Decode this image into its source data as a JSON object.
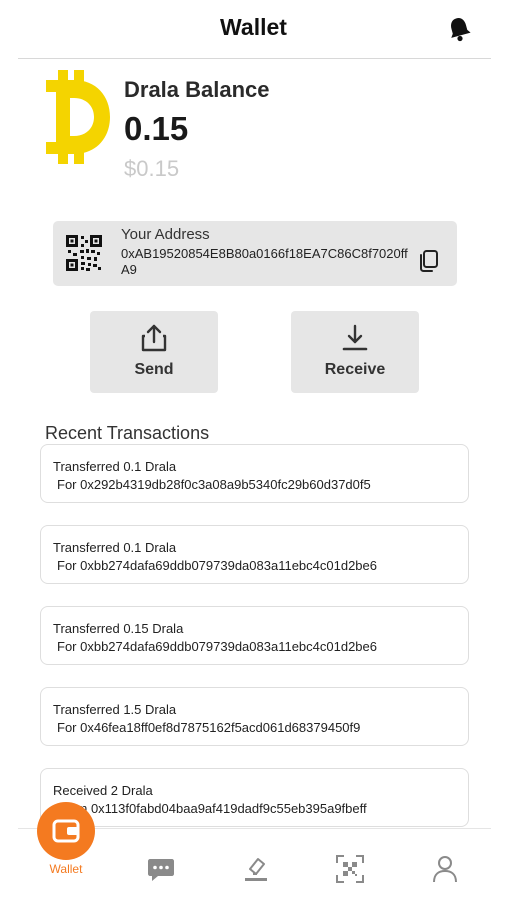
{
  "header": {
    "title": "Wallet",
    "notification_icon": "bell-icon"
  },
  "balance": {
    "title": "Drala Balance",
    "amount": "0.15",
    "fiat": "$0.15",
    "coin_icon": "drala-coin-icon",
    "coin_color": "#f4d400"
  },
  "address": {
    "label": "Your Address",
    "value": "0xAB19520854E8B80a0166f18EA7C86C8f7020ffA9",
    "qr_icon": "qr-code-icon",
    "copy_icon": "copy-icon"
  },
  "actions": {
    "send": {
      "label": "Send",
      "icon": "upload-icon"
    },
    "receive": {
      "label": "Receive",
      "icon": "download-icon"
    }
  },
  "transactions": {
    "heading": "Recent Transactions",
    "items": [
      {
        "title": "Transferred 0.1 Drala",
        "detail": "For 0x292b4319db28f0c3a08a9b5340fc29b60d37d0f5"
      },
      {
        "title": "Transferred 0.1 Drala",
        "detail": "For 0xbb274dafa69ddb079739da083a11ebc4c01d2be6"
      },
      {
        "title": "Transferred 0.15 Drala",
        "detail": "For 0xbb274dafa69ddb079739da083a11ebc4c01d2be6"
      },
      {
        "title": "Transferred 1.5 Drala",
        "detail": "For 0x46fea18ff0ef8d7875162f5acd061d68379450f9"
      },
      {
        "title": "Received 2 Drala",
        "detail": "From 0x113f0fabd04baa9af419dadf9c55eb395a9fbeff"
      }
    ]
  },
  "nav": {
    "wallet_label": "Wallet",
    "items": [
      "wallet-icon",
      "chat-icon",
      "swap-icon",
      "scan-icon",
      "profile-icon"
    ],
    "accent": "#f47a20"
  }
}
